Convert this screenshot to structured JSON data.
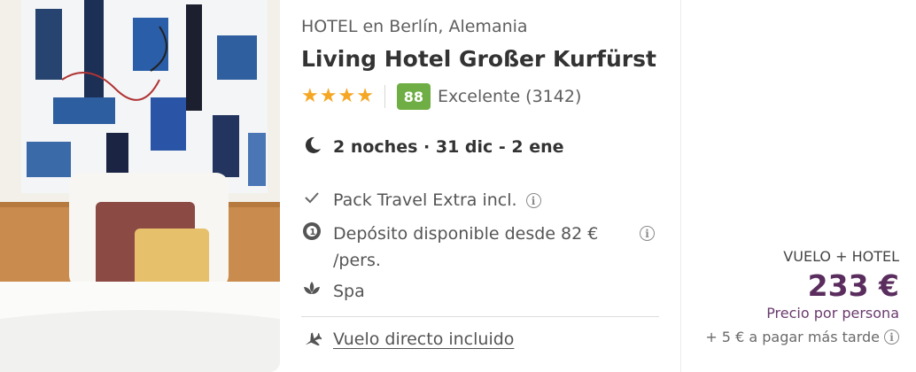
{
  "hotel": {
    "type_location": "HOTEL en Berlín, Alemania",
    "name": "Living Hotel Großer Kurfürst",
    "stars": 4,
    "score": "88",
    "score_label": "Excelente (3142)"
  },
  "stay": {
    "dates": "2 noches · 31 dic - 2 ene"
  },
  "features": [
    {
      "icon": "check-icon",
      "label": "Pack Travel Extra incl."
    },
    {
      "icon": "deposit-icon",
      "label": "Depósito disponible desde 82 € /pers."
    },
    {
      "icon": "spa-icon",
      "label": "Spa"
    }
  ],
  "flight": {
    "icon": "airplane-icon",
    "label": "Vuelo directo incluido"
  },
  "price": {
    "package_type": "VUELO + HOTEL",
    "amount": "233 €",
    "per_person": "Precio por persona",
    "extra": "+ 5 € a pagar más tarde"
  },
  "colors": {
    "star": "#f5a623",
    "score_badge": "#6fae44",
    "price": "#5a2d5e"
  }
}
